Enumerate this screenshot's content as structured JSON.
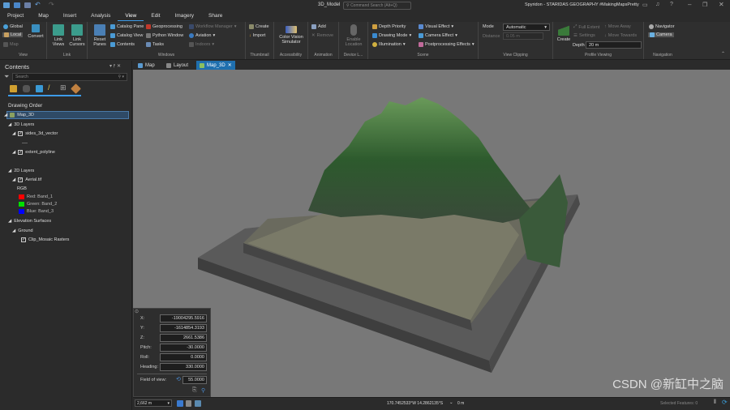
{
  "app": {
    "project_title": "3D_Model",
    "command_search_placeholder": "Command Search (Alt+Q)",
    "user": "Spyridon - STARIDAS GEOGRAPHY #MakingMapsPretty"
  },
  "tabs": [
    "Project",
    "Map",
    "Insert",
    "Analysis",
    "View",
    "Edit",
    "Imagery",
    "Share"
  ],
  "active_tab": "View",
  "ribbon": {
    "view": {
      "label": "View",
      "global": "Global",
      "local": "Local",
      "map": "Map",
      "convert": "Convert"
    },
    "link": {
      "label": "Link",
      "link_views": "Link Views",
      "link_cursors": "Link Cursors"
    },
    "windows": {
      "label": "Windows",
      "reset_panes": "Reset Panes",
      "catalog_pane": "Catalog Pane",
      "catalog_view": "Catalog View",
      "contents": "Contents",
      "geoprocessing": "Geoprocessing",
      "python_window": "Python Window",
      "tasks": "Tasks",
      "workflow_manager": "Workflow Manager",
      "aviation": "Aviation",
      "indoors": "Indoors"
    },
    "thumbnail": {
      "label": "Thumbnail",
      "create": "Create",
      "import": "Import"
    },
    "accessibility": {
      "label": "Accessibility",
      "color_vision": "Color Vision Simulator"
    },
    "animation": {
      "label": "Animation",
      "add": "Add",
      "remove": "Remove"
    },
    "device": {
      "label": "Device L...",
      "enable_location": "Enable Location"
    },
    "scene": {
      "label": "Scene",
      "depth_priority": "Depth Priority",
      "drawing_mode": "Drawing Mode",
      "illumination": "Illumination",
      "visual_effect": "Visual Effect",
      "camera_effect": "Camera Effect",
      "postprocessing": "Postprocessing Effects"
    },
    "clipping": {
      "label": "View Clipping",
      "mode_label": "Mode",
      "mode_value": "Automatic",
      "distance_label": "Distance",
      "distance_value": "0.05 m"
    },
    "profile": {
      "label": "Profile Viewing",
      "create": "Create",
      "full_extent": "Full Extent",
      "settings": "Settings",
      "move_away": "Move Away",
      "move_towards": "Move Towards",
      "depth_label": "Depth",
      "depth_value": "20 m"
    },
    "navigation": {
      "label": "Navigation",
      "navigator": "Navigator",
      "camera": "Camera"
    }
  },
  "contents": {
    "title": "Contents",
    "search_placeholder": "Search",
    "drawing_order": "Drawing Order",
    "map": "Map_3D",
    "layers3d": "3D Layers",
    "sides": "sides_3d_vector",
    "extent": "extent_polyline",
    "layers2d": "2D Layers",
    "aerial": "Aerial.tif",
    "rgb": "RGB",
    "bands": [
      {
        "label": "Red:   Band_1",
        "color": "#ff0000"
      },
      {
        "label": "Green: Band_2",
        "color": "#00e000"
      },
      {
        "label": "Blue:  Band_3",
        "color": "#0000ff"
      }
    ],
    "elev": "Elevation Surfaces",
    "ground": "Ground",
    "clip": "Clip_Mosaic Rasters"
  },
  "doc_tabs": [
    "Map",
    "Layout",
    "Map_3D"
  ],
  "active_doc": "Map_3D",
  "camera": {
    "x_label": "X:",
    "x": "-19004295.5916",
    "y_label": "Y:",
    "y": "-1614854.3193",
    "z_label": "Z:",
    "z": "2661.5386",
    "pitch_label": "Pitch:",
    "pitch": "-30.0000",
    "roll_label": "Roll:",
    "roll": "0.0000",
    "heading_label": "Heading:",
    "heading": "330.0000",
    "fov_label": "Field of view:",
    "fov": "55.0000"
  },
  "status": {
    "scale": "2,662 m",
    "coords": "170.7452533°W 14.2862135°S",
    "elev": "0 m",
    "selected": "Selected Features: 0"
  },
  "watermark": "CSDN @新缸中之脑"
}
